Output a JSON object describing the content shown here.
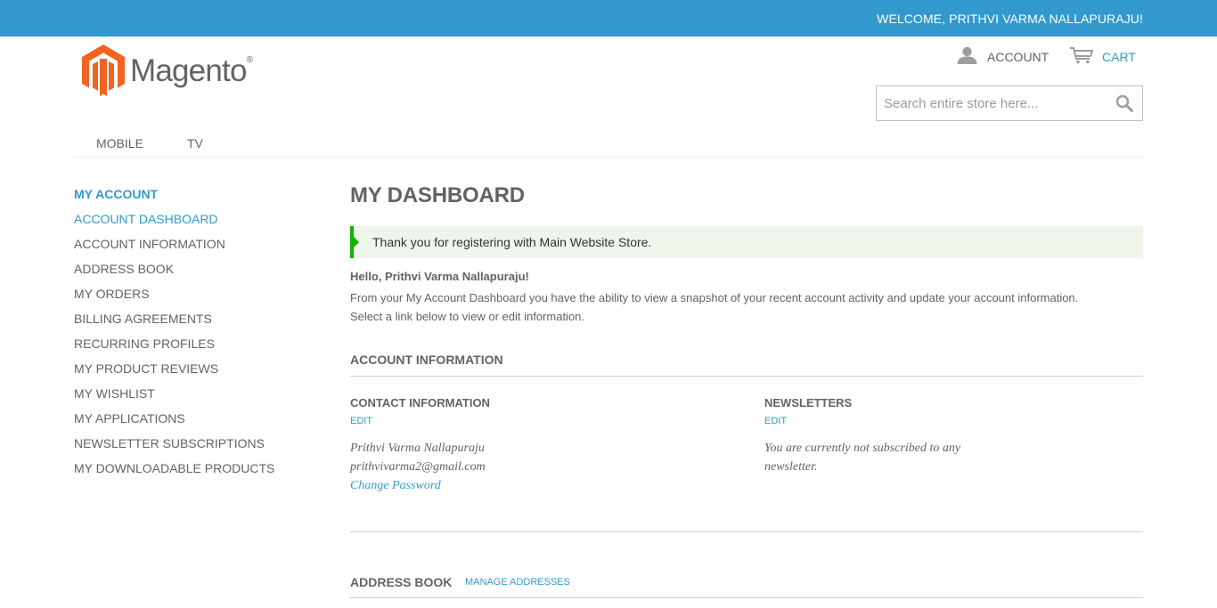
{
  "header": {
    "welcome": "WELCOME, PRITHVI VARMA NALLAPURAJU!",
    "logo_text": "Magento",
    "logo_reg": "®",
    "account_label": "ACCOUNT",
    "cart_label": "CART",
    "search_placeholder": "Search entire store here..."
  },
  "nav": [
    "MOBILE",
    "TV"
  ],
  "sidebar": {
    "title": "MY ACCOUNT",
    "items": [
      "ACCOUNT DASHBOARD",
      "ACCOUNT INFORMATION",
      "ADDRESS BOOK",
      "MY ORDERS",
      "BILLING AGREEMENTS",
      "RECURRING PROFILES",
      "MY PRODUCT REVIEWS",
      "MY WISHLIST",
      "MY APPLICATIONS",
      "NEWSLETTER SUBSCRIPTIONS",
      "MY DOWNLOADABLE PRODUCTS"
    ],
    "active_index": 0
  },
  "main": {
    "title": "MY DASHBOARD",
    "notice": "Thank you for registering with Main Website Store.",
    "hello": "Hello, Prithvi Varma Nallapuraju!",
    "intro": "From your My Account Dashboard you have the ability to view a snapshot of your recent account activity and update your account information. Select a link below to view or edit information.",
    "account_info_title": "ACCOUNT INFORMATION",
    "contact": {
      "title": "CONTACT INFORMATION",
      "edit": "EDIT",
      "name": "Prithvi Varma Nallapuraju",
      "email": "prithvivarma2@gmail.com",
      "change_password": "Change Password"
    },
    "newsletters": {
      "title": "NEWSLETTERS",
      "edit": "EDIT",
      "text": "You are currently not subscribed to any newsletter."
    },
    "address_book_title": "ADDRESS BOOK",
    "manage_addresses": "MANAGE ADDRESSES"
  },
  "colors": {
    "topbar": "#3399cc",
    "link": "#3399cc",
    "notice_bg": "#eff5ea",
    "notice_accent": "#11b400",
    "logo_orange": "#f26322"
  },
  "icons": [
    "magento-logo-icon",
    "user-icon",
    "cart-icon",
    "search-icon"
  ]
}
